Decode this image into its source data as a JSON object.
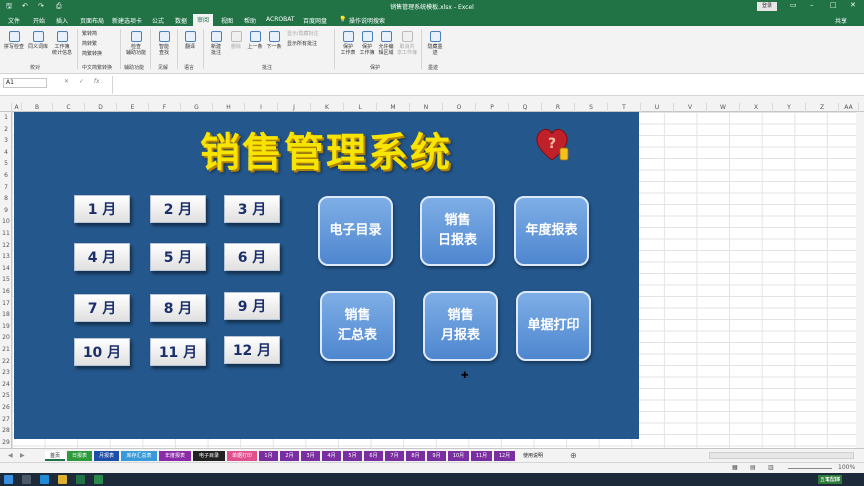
{
  "window": {
    "title": "销售管理系统模板.xlsx - Excel",
    "login_label": "登录",
    "share_label": "共享"
  },
  "menu": {
    "tabs": [
      "文件",
      "开始",
      "插入",
      "页面布局",
      "新建选项卡",
      "公式",
      "数据",
      "审阅",
      "视图",
      "帮助",
      "ACROBAT",
      "百度网盘"
    ],
    "active": "审阅",
    "tell_me": "操作说明搜索"
  },
  "ribbon": {
    "buttons": [
      {
        "label": "拼写检查"
      },
      {
        "label": "同义词库"
      },
      {
        "label": "工作簿\n统计信息"
      },
      {
        "label": "检查\n辅助功能"
      },
      {
        "label": "智能\n查找"
      },
      {
        "label": "翻译"
      },
      {
        "label": "新建\n批注"
      },
      {
        "label": "删除"
      },
      {
        "label": "上一条"
      },
      {
        "label": "下一条"
      },
      {
        "label": "保护\n工作表"
      },
      {
        "label": "保护\n工作簿"
      },
      {
        "label": "允许编\n辑区域"
      },
      {
        "label": "取消共\n享工作簿"
      },
      {
        "label": "隐藏墨\n迹"
      }
    ],
    "chinese_items": [
      "繁转简",
      "简转繁",
      "简繁转换"
    ],
    "comment_items": [
      "显示/隐藏批注",
      "显示所有批注"
    ],
    "groups": [
      "校对",
      "中文简繁转换",
      "辅助功能",
      "见解",
      "语言",
      "批注",
      "保护",
      "墨迹"
    ]
  },
  "formula_bar": {
    "name_box": "A1",
    "fx": "fx",
    "value": ""
  },
  "columns": [
    "A",
    "B",
    "C",
    "D",
    "E",
    "F",
    "G",
    "H",
    "I",
    "J",
    "K",
    "L",
    "M",
    "N",
    "O",
    "P",
    "Q",
    "R",
    "S",
    "T",
    "U",
    "V",
    "W",
    "X",
    "Y",
    "Z",
    "AA"
  ],
  "rows": [
    "1",
    "2",
    "3",
    "4",
    "5",
    "6",
    "7",
    "8",
    "9",
    "10",
    "11",
    "12",
    "13",
    "14",
    "15",
    "16",
    "17",
    "18",
    "19",
    "20",
    "21",
    "22",
    "23",
    "24",
    "25",
    "26",
    "27",
    "28",
    "29"
  ],
  "dashboard": {
    "title": "销售管理系统",
    "months": [
      "1 月",
      "2 月",
      "3 月",
      "4 月",
      "5 月",
      "6 月",
      "7 月",
      "8 月",
      "9 月",
      "10 月",
      "11 月",
      "12 月"
    ],
    "buttons": [
      {
        "line1": "电子目录",
        "line2": ""
      },
      {
        "line1": "销售",
        "line2": "日报表"
      },
      {
        "line1": "年度报表",
        "line2": ""
      },
      {
        "line1": "销售",
        "line2": "汇总表"
      },
      {
        "line1": "销售",
        "line2": "月报表"
      },
      {
        "line1": "单据打印",
        "line2": ""
      }
    ]
  },
  "sheets": [
    {
      "name": "首页",
      "color": "#ffffff",
      "text": "#222222"
    },
    {
      "name": "日报表",
      "color": "#2e9a3c",
      "text": "#ffffff"
    },
    {
      "name": "月报表",
      "color": "#1e4fa8",
      "text": "#ffffff"
    },
    {
      "name": "库存汇总表",
      "color": "#3a9ad9",
      "text": "#ffffff"
    },
    {
      "name": "年度报表",
      "color": "#8a2aa8",
      "text": "#ffffff"
    },
    {
      "name": "电子目录",
      "color": "#222222",
      "text": "#ffffff"
    },
    {
      "name": "单据打印",
      "color": "#e0508f",
      "text": "#ffffff"
    },
    {
      "name": "1月",
      "color": "#7a2fa0",
      "text": "#ffffff"
    },
    {
      "name": "2月",
      "color": "#7a2fa0",
      "text": "#ffffff"
    },
    {
      "name": "3月",
      "color": "#7a2fa0",
      "text": "#ffffff"
    },
    {
      "name": "4月",
      "color": "#7a2fa0",
      "text": "#ffffff"
    },
    {
      "name": "5月",
      "color": "#7a2fa0",
      "text": "#ffffff"
    },
    {
      "name": "6月",
      "color": "#7a2fa0",
      "text": "#ffffff"
    },
    {
      "name": "7月",
      "color": "#7a2fa0",
      "text": "#ffffff"
    },
    {
      "name": "8月",
      "color": "#7a2fa0",
      "text": "#ffffff"
    },
    {
      "name": "9月",
      "color": "#7a2fa0",
      "text": "#ffffff"
    },
    {
      "name": "10月",
      "color": "#7a2fa0",
      "text": "#ffffff"
    },
    {
      "name": "11月",
      "color": "#7a2fa0",
      "text": "#ffffff"
    },
    {
      "name": "12月",
      "color": "#7a2fa0",
      "text": "#ffffff"
    },
    {
      "name": "使用说明",
      "color": "#f3f3f3",
      "text": "#222222"
    }
  ],
  "status": {
    "zoom": "100%"
  },
  "taskbar": {
    "time": "17:15",
    "input": "五笔型拼"
  },
  "colors": {
    "excel_green": "#217346",
    "canvas_blue": "#24578c",
    "title_yellow": "#f7e400"
  }
}
